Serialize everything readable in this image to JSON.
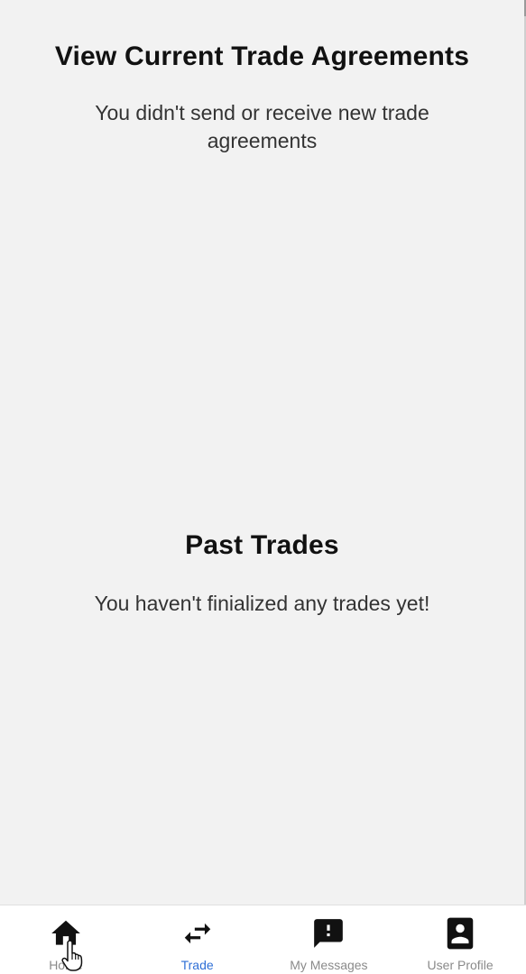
{
  "agreements": {
    "title": "View Current Trade Agreements",
    "empty_text": "You didn't send or receive new trade agreements"
  },
  "past_trades": {
    "title": "Past Trades",
    "empty_text": "You haven't finialized any trades yet!"
  },
  "tabbar": {
    "active_color": "#2f6fd6",
    "items": [
      {
        "label": "Home",
        "icon": "home-icon"
      },
      {
        "label": "Trade",
        "icon": "swap-arrows-icon",
        "active": true
      },
      {
        "label": "My Messages",
        "icon": "message-alert-icon"
      },
      {
        "label": "User Profile",
        "icon": "contact-card-icon"
      }
    ]
  },
  "cursor": {
    "icon": "hand-pointer-icon"
  }
}
